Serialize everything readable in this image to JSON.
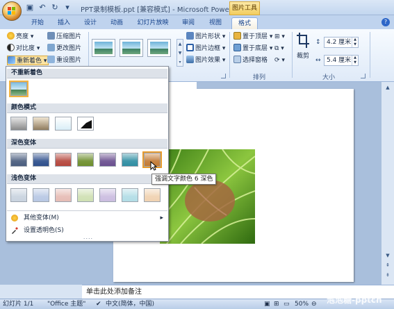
{
  "app": {
    "title": "PPT录制模板.ppt [兼容模式] - Microsoft PowerP...",
    "context_tool": "图片工具"
  },
  "tabs": [
    {
      "label": "开始"
    },
    {
      "label": "插入"
    },
    {
      "label": "设计"
    },
    {
      "label": "动画"
    },
    {
      "label": "幻灯片放映"
    },
    {
      "label": "审阅"
    },
    {
      "label": "视图"
    },
    {
      "label": "格式",
      "active": true
    }
  ],
  "ribbon": {
    "adjust": {
      "brightness": "亮度",
      "contrast": "对比度",
      "recolor": "重新着色",
      "compress": "压缩图片",
      "change": "更改图片",
      "reset": "重设图片"
    },
    "picture_styles": {
      "shape": "图片形状",
      "border": "图片边框",
      "effects": "图片效果"
    },
    "arrange": {
      "bring_front": "置于顶层",
      "send_back": "置于底层",
      "selection_pane": "选择窗格",
      "label": "排列"
    },
    "size": {
      "crop": "裁剪",
      "height": "4.2 厘米",
      "width": "5.4 厘米",
      "label": "大小"
    }
  },
  "recolor_menu": {
    "no_recolor": "不重新着色",
    "color_modes": "颜色模式",
    "dark_variations": "深色变体",
    "light_variations": "浅色变体",
    "more_variations": "其他变体(M)",
    "set_transparent": "设置透明色(S)",
    "grip": "....",
    "colors": {
      "dark": [
        "#4a5d7e",
        "#2e4f8c",
        "#b5473d",
        "#6e8f2e",
        "#6a4f8f",
        "#2f8ea3",
        "#c27a35"
      ],
      "light": [
        "#c9d3df",
        "#b8c8e4",
        "#e6bcb5",
        "#cfe0b3",
        "#cbbde0",
        "#b2dde6",
        "#f0d2b1"
      ]
    }
  },
  "tooltip": "强调文字颜色 6 深色",
  "notes_placeholder": "单击此处添加备注",
  "status": {
    "slide": "幻灯片 1/1",
    "theme": "\"Office 主题\"",
    "language": "中文(简体，中国)",
    "zoom": "50%"
  },
  "watermark": "泡泡糖-pptcn"
}
